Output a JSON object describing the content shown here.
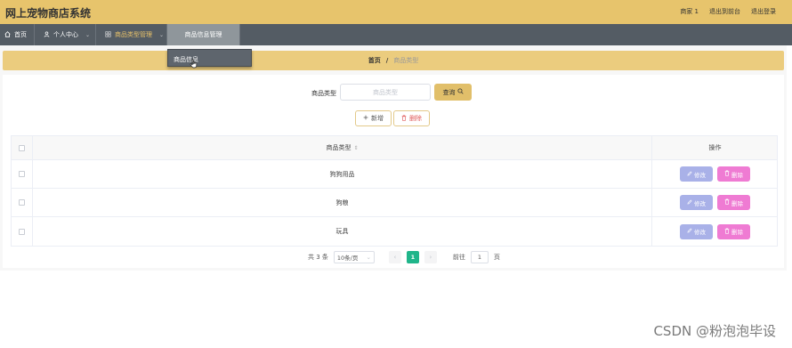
{
  "app": {
    "title": "网上宠物商店系统"
  },
  "header": {
    "user_label": "商家 1",
    "exit_to_front_label": "退出到前台",
    "logout_label": "退出登录"
  },
  "nav": {
    "home": "首页",
    "personal": "个人中心",
    "category": "商品类型管理",
    "product": "商品信息管理"
  },
  "dropdown": {
    "item": "商品信息"
  },
  "breadcrumb": {
    "home": "首页",
    "separator": "/",
    "current": "商品类型"
  },
  "search": {
    "label": "商品类型",
    "placeholder": "商品类型",
    "query_label": "查询"
  },
  "actions": {
    "add_label": "新增",
    "delete_label": "删除"
  },
  "table": {
    "headers": {
      "type": "商品类型",
      "ops": "操作"
    },
    "rows": [
      {
        "type": "狗狗用品"
      },
      {
        "type": "狗粮"
      },
      {
        "type": "玩具"
      }
    ],
    "edit_label": "修改",
    "remove_label": "删除"
  },
  "pager": {
    "total": "共 3 条",
    "page_size": "10条/页",
    "current_page": "1",
    "goto_label": "前往",
    "goto_value": "1",
    "page_unit": "页"
  },
  "watermark": "CSDN @粉泡泡毕设",
  "colors": {
    "topbar": "#e7c46c",
    "navbar": "#545c64",
    "breadcrumb": "#ebcc7e",
    "query_button": "#e1bf6a",
    "edit_button": "#a9b1e8",
    "remove_button": "#ef7bd3",
    "active_page": "#20b58a"
  }
}
